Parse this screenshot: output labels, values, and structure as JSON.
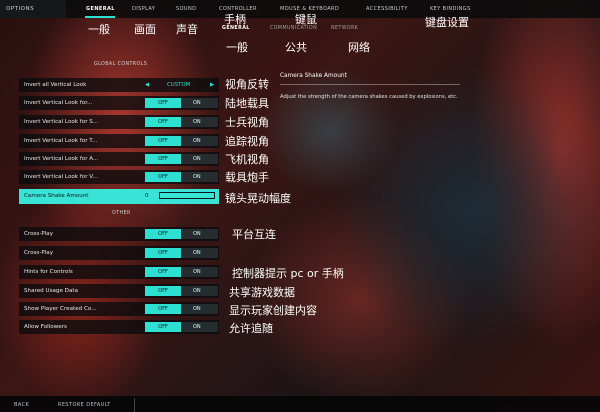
{
  "topbar": {
    "options_label": "OPTIONS",
    "tabs": [
      {
        "label": "GENERAL",
        "active": true
      },
      {
        "label": "DISPLAY",
        "active": false
      },
      {
        "label": "SOUND",
        "active": false
      },
      {
        "label": "CONTROLLER",
        "active": false
      },
      {
        "label": "MOUSE & KEYBOARD",
        "active": false
      },
      {
        "label": "ACCESSIBILITY",
        "active": false
      },
      {
        "label": "KEY BINDINGS",
        "active": false
      }
    ]
  },
  "subtabs": [
    {
      "label": "GENERAL",
      "active": true
    },
    {
      "label": "COMMUNICATION",
      "active": false
    },
    {
      "label": "NETWORK",
      "active": false
    }
  ],
  "annotations_top": {
    "general": "一般",
    "display": "画面",
    "sound": "声音",
    "controller": "手柄",
    "mouse_keyboard": "键鼠",
    "key_bindings": "键盘设置",
    "sub_general": "一般",
    "sub_communication": "公共",
    "sub_network": "网络"
  },
  "global_controls": {
    "title": "GLOBAL CONTROLS",
    "invert_all": {
      "label": "Invert all Vertical Look",
      "value": "CUSTOM",
      "arrow_left": "◀",
      "arrow_right": "▶",
      "annotation": "视角反转"
    },
    "rows": [
      {
        "label": "Invert Vertical Look for...",
        "off": "OFF",
        "on": "ON",
        "annotation": "陆地载具"
      },
      {
        "label": "Invert Vertical Look for S...",
        "off": "OFF",
        "on": "ON",
        "annotation": "士兵视角"
      },
      {
        "label": "Invert Vertical Look for T...",
        "off": "OFF",
        "on": "ON",
        "annotation": "追踪视角"
      },
      {
        "label": "Invert Vertical Look for A...",
        "off": "OFF",
        "on": "ON",
        "annotation": "飞机视角"
      },
      {
        "label": "Invert Vertical Look for V...",
        "off": "OFF",
        "on": "ON",
        "annotation": "载具炮手"
      }
    ],
    "camera_shake": {
      "label": "Camera Shake Amount",
      "value": "0",
      "annotation": "镜头晃动幅度"
    }
  },
  "other": {
    "title": "OTHER",
    "rows": [
      {
        "label": "Cross-Play",
        "off": "OFF",
        "on": "ON",
        "annotation": "平台互连"
      },
      {
        "label": "Cross-Play",
        "off": "OFF",
        "on": "ON",
        "annotation": ""
      },
      {
        "label": "Hints for Controls",
        "off": "OFF",
        "on": "ON",
        "annotation": "控制器提示 pc or 手柄"
      },
      {
        "label": "Shared Usage Data",
        "off": "OFF",
        "on": "ON",
        "annotation": "共享游戏数据"
      },
      {
        "label": "Show Player Created Co...",
        "off": "OFF",
        "on": "ON",
        "annotation": "显示玩家创建内容"
      },
      {
        "label": "Allow Followers",
        "off": "OFF",
        "on": "ON",
        "annotation": "允许追随"
      }
    ]
  },
  "description": {
    "title": "Camera Shake Amount",
    "text": "Adjust the strength of the camera shakes caused by explosions, etc."
  },
  "bottombar": {
    "back": "BACK",
    "restore": "RESTORE DEFAULT"
  },
  "colors": {
    "accent": "#2ee0d2",
    "highlight": "#39e3d6"
  }
}
